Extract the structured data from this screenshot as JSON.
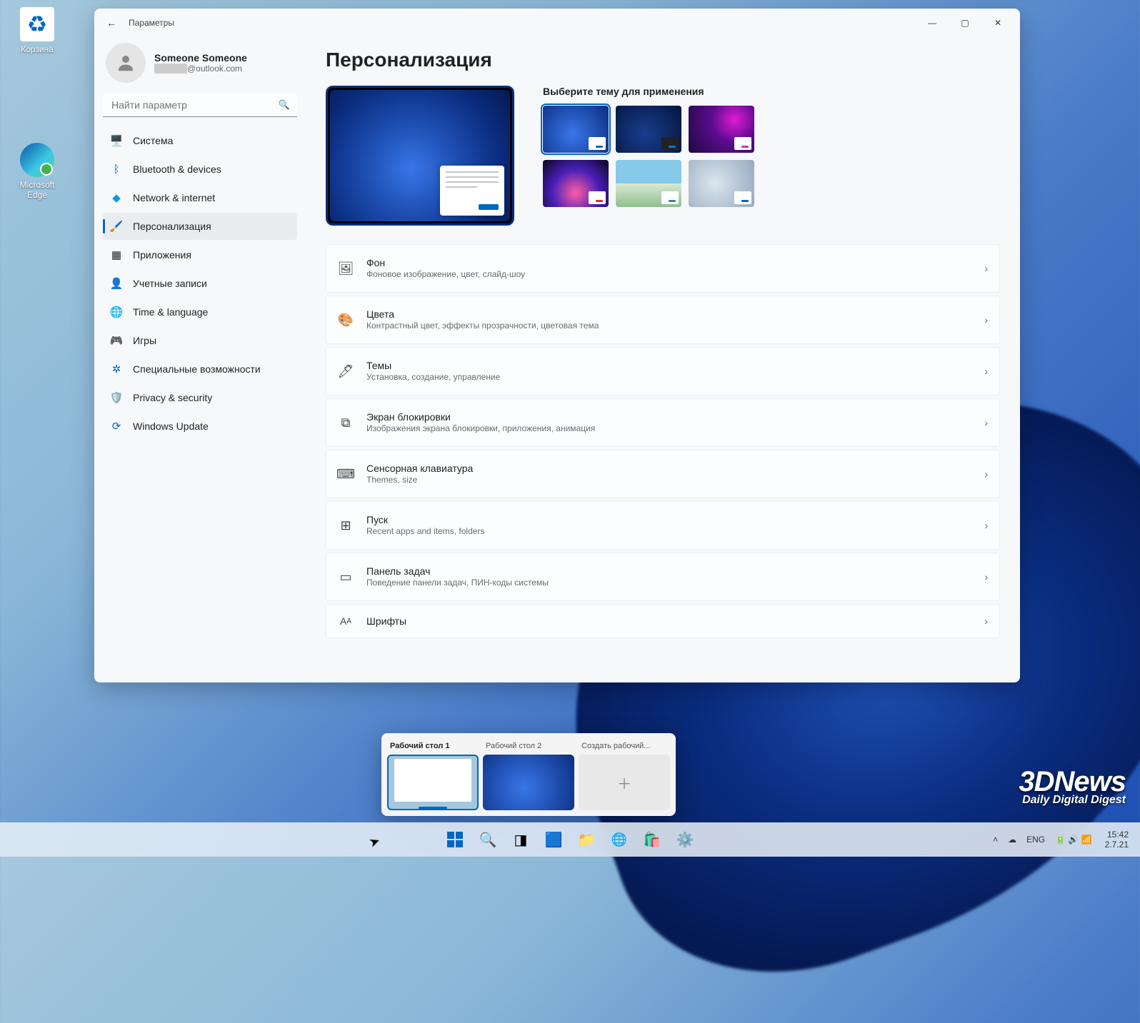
{
  "desktop": {
    "recycle_bin": "Корзина",
    "edge": "Microsoft Edge"
  },
  "window": {
    "title": "Параметры",
    "account_name": "Someone Someone",
    "account_email_suffix": "@outlook.com",
    "search_placeholder": "Найти параметр"
  },
  "nav": {
    "system": "Система",
    "bluetooth": "Bluetooth & devices",
    "network": "Network & internet",
    "personalization": "Персонализация",
    "apps": "Приложения",
    "accounts": "Учетные записи",
    "time": "Time & language",
    "gaming": "Игры",
    "accessibility": "Специальные возможности",
    "privacy": "Privacy & security",
    "update": "Windows Update"
  },
  "page": {
    "title": "Персонализация",
    "themes_heading": "Выберите тему для применения"
  },
  "rows": {
    "bg_t": "Фон",
    "bg_s": "Фоновое изображение, цвет, слайд-шоу",
    "color_t": "Цвета",
    "color_s": "Контрастный цвет, эффекты прозрачности, цветовая тема",
    "themes_t": "Темы",
    "themes_s": "Установка, создание, управление",
    "lock_t": "Экран блокировки",
    "lock_s": "Изображения экрана блокировки, приложения, анимация",
    "kb_t": "Сенсорная клавиатура",
    "kb_s": "Themes, size",
    "start_t": "Пуск",
    "start_s": "Recent apps and items, folders",
    "taskbar_t": "Панель задач",
    "taskbar_s": "Поведение панели задач, ПИН-коды системы",
    "fonts_t": "Шрифты"
  },
  "taskview": {
    "desk1": "Рабочий стол 1",
    "desk2": "Рабочий стол 2",
    "new": "Создать рабочий..."
  },
  "tray": {
    "lang": "ENG",
    "time": "15:42",
    "date": "2.7.21"
  },
  "watermark": {
    "brand": "3DNews",
    "tagline": "Daily Digital Digest"
  }
}
